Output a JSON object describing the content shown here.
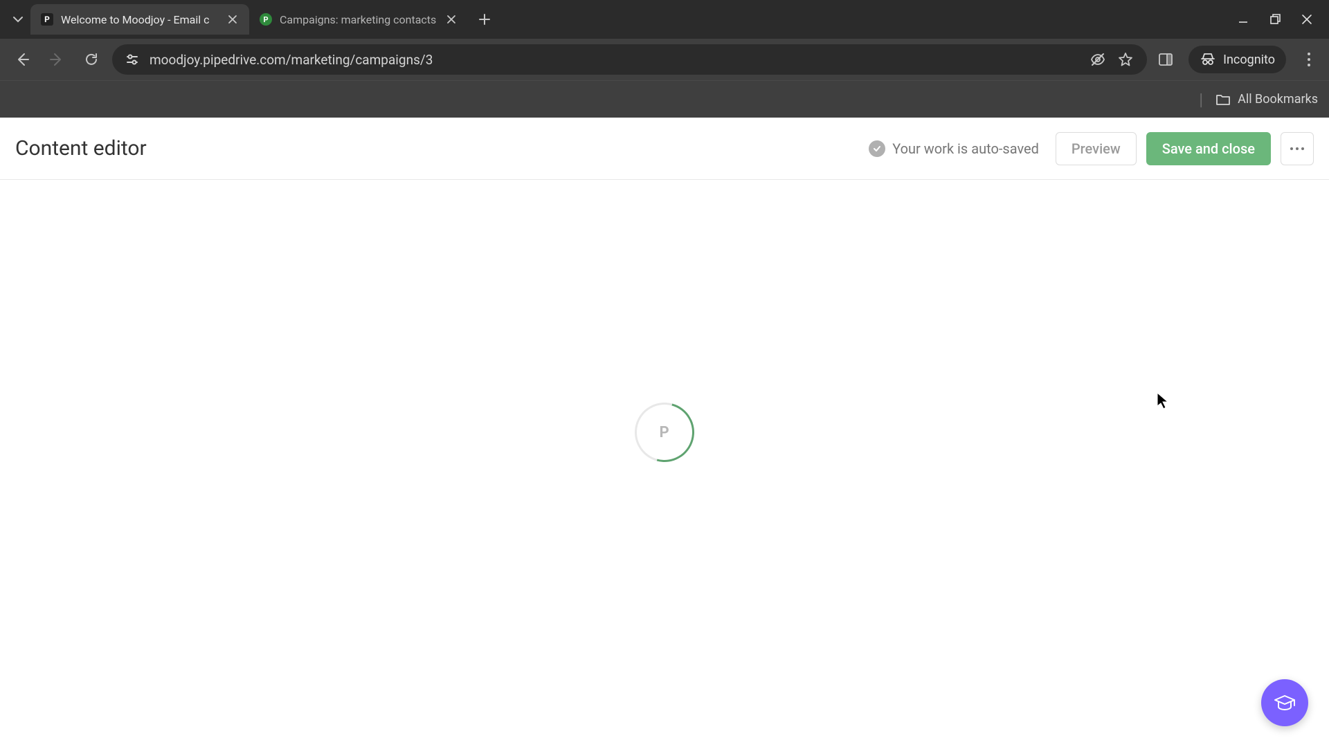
{
  "browser": {
    "tabs": [
      {
        "title": "Welcome to Moodjoy - Email c",
        "favicon_letter": "P",
        "active": true
      },
      {
        "title": "Campaigns: marketing contacts",
        "favicon_letter": "P",
        "active": false
      }
    ],
    "url": "moodjoy.pipedrive.com/marketing/campaigns/3",
    "incognito_label": "Incognito",
    "all_bookmarks_label": "All Bookmarks"
  },
  "app": {
    "page_title": "Content editor",
    "autosave_text": "Your work is auto-saved",
    "preview_label": "Preview",
    "save_label": "Save and close",
    "spinner_letter": "P"
  }
}
